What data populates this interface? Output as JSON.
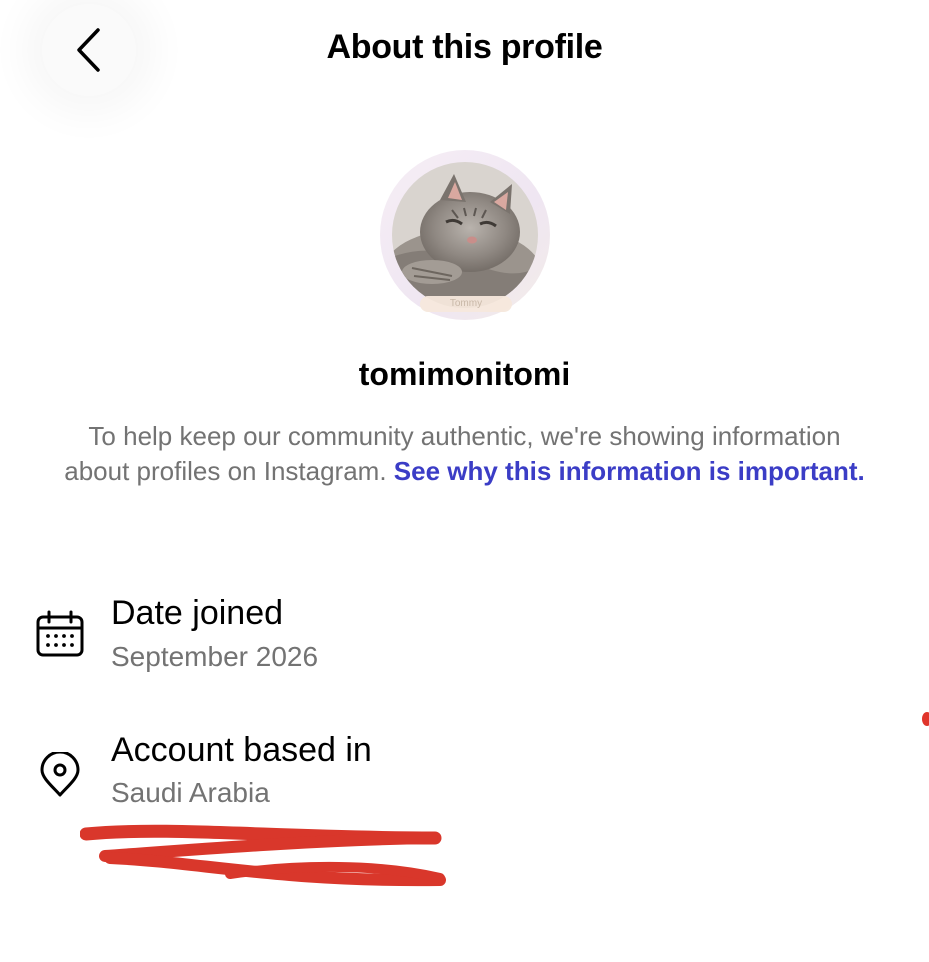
{
  "header": {
    "title": "About this profile",
    "back_icon": "chevron-left-icon"
  },
  "profile": {
    "avatar_description": "sleeping-gray-kitten-avatar",
    "avatar_tag": "Tommy",
    "username": "tomimonitomi"
  },
  "info": {
    "text": "To help keep our community authentic, we're showing information about profiles on Instagram.",
    "link": "See why this information is important."
  },
  "details": [
    {
      "icon": "calendar-icon",
      "label": "Date joined",
      "value": "September 2026"
    },
    {
      "icon": "location-pin-icon",
      "label": "Account based in",
      "value": "Saudi Arabia"
    }
  ],
  "colors": {
    "link": "#3b3dc6",
    "secondary_text": "#737373",
    "redaction": "#d9372b"
  }
}
